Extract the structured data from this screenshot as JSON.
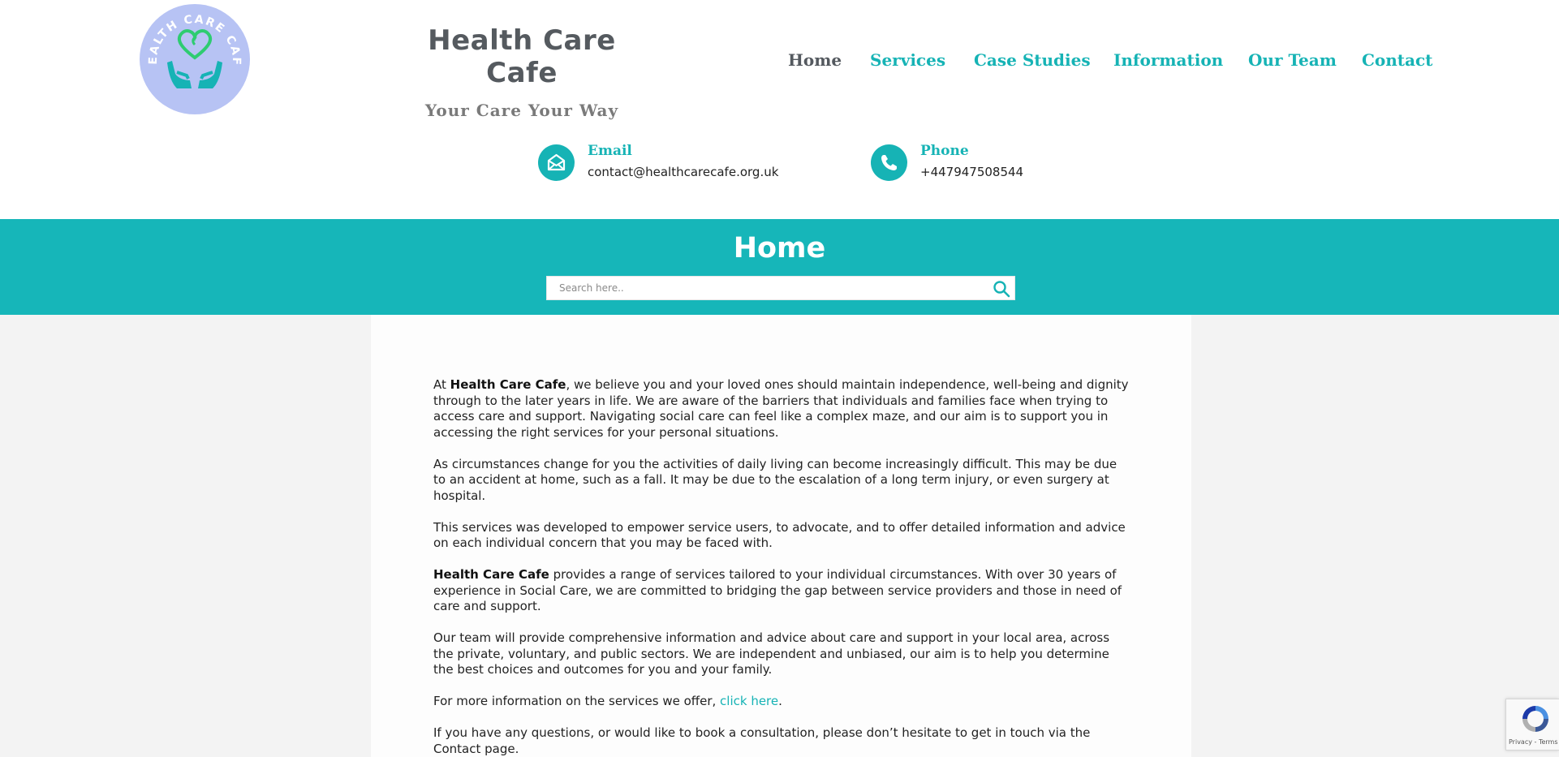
{
  "header": {
    "logo_text": "HEALTH CARE CAFE",
    "brand_title": "Health Care Cafe",
    "tagline": "Your Care Your Way",
    "nav": [
      {
        "label": "Home",
        "active": true
      },
      {
        "label": "Services",
        "active": false
      },
      {
        "label": "Case Studies",
        "active": false
      },
      {
        "label": "Information",
        "active": false
      },
      {
        "label": "Our Team",
        "active": false
      },
      {
        "label": "Contact",
        "active": false
      }
    ],
    "contacts": {
      "email": {
        "label": "Email",
        "value": "contact@healthcarecafe.org.uk",
        "icon": "envelope-open-icon"
      },
      "phone": {
        "label": "Phone",
        "value": "+447947508544",
        "icon": "phone-icon"
      }
    }
  },
  "banner": {
    "title": "Home",
    "search_placeholder": "Search here..",
    "search_icon": "search-icon"
  },
  "content": {
    "p1_before": "At ",
    "p1_bold": "Health Care Cafe",
    "p1_after": ", we believe you and your loved ones should maintain independence, well-being and dignity through to the later years in life. We are aware of the barriers that individuals and families face when trying to access care and support. Navigating social care can feel like a complex maze, and our aim is to support you in accessing the right services for your personal situations.",
    "p2": "As circumstances change for you the activities of daily living can become increasingly difficult.  This may be due to an accident at home, such as a fall. It may be due to the escalation of a long term injury, or even surgery at hospital.",
    "p3": "This services was developed to empower service users, to advocate, and to offer detailed information and advice on each individual concern that you may be faced with.",
    "p4_bold": "Health Care Cafe",
    "p4_after": " provides a range of services tailored to your individual circumstances. With over 30 years of experience in Social Care, we are committed to bridging the gap between service providers and those in need of care and support.",
    "p5": "Our team will provide comprehensive information and advice about care and support in your local area, across the private, voluntary, and public sectors. We are independent and unbiased, our aim is to help you determine the best choices and outcomes  for you and your family.",
    "p6_before": "For more information on the services we offer, ",
    "p6_link": "click here",
    "p6_after": ".",
    "p7": "If you have any questions, or would like to book a consultation, please don’t hesitate to get in touch via the Contact page."
  },
  "recaptcha": {
    "text": "Privacy - Terms"
  },
  "colors": {
    "accent": "#16b3b5",
    "banner": "#16b6b9",
    "logo_bg": "#b7c3f4",
    "nav_active": "#54595f"
  }
}
